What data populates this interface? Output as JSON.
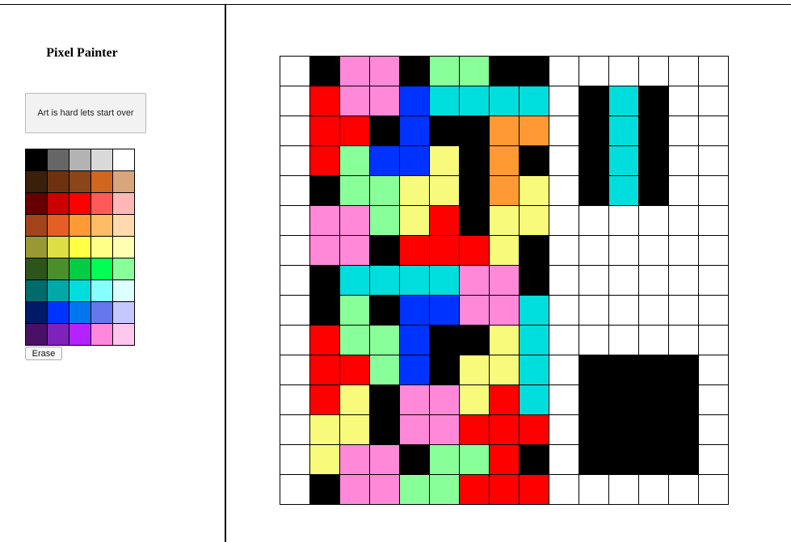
{
  "app": {
    "title": "Pixel Painter"
  },
  "sidebar": {
    "reset_label": "Art is hard lets start over",
    "erase_label": "Erase"
  },
  "palette": {
    "colors": [
      "#000000",
      "#666666",
      "#b3b3b3",
      "#d9d9d9",
      "#ffffff",
      "#3a1f0b",
      "#6e3210",
      "#8a4518",
      "#d1661f",
      "#d9a57d",
      "#660000",
      "#cc0000",
      "#ff0000",
      "#ff5a5a",
      "#ffb7b7",
      "#a3441a",
      "#e55e25",
      "#ff9933",
      "#ffbb66",
      "#ffd9b0",
      "#999933",
      "#dddd44",
      "#ffff44",
      "#ffff88",
      "#ffffb3",
      "#2d5419",
      "#4a8f2a",
      "#00cc44",
      "#00ff55",
      "#88ff99",
      "#006b6b",
      "#00a8a8",
      "#00dddd",
      "#88ffff",
      "#ddffff",
      "#001a66",
      "#0033ff",
      "#0077ee",
      "#6677ee",
      "#c7c7ff",
      "#4a1066",
      "#7f22bb",
      "#b422ff",
      "#ff88dd",
      "#ffc7ee"
    ]
  },
  "canvas": {
    "colors": {
      "W": "#ffffff",
      "K": "#000000",
      "P": "#ff88d8",
      "G": "#88ff99",
      "R": "#ff0000",
      "B": "#0033ff",
      "C": "#00dddd",
      "O": "#ff9933",
      "Y": "#f7fa7a"
    },
    "rows": [
      "WKPPKGGKKWWWWWW",
      "WRPPBCCCCWKCKWW",
      "WRRKBKKOOWKCKWW",
      "WRGBBYKOKWKCKWW",
      "WKGGYYKOYWKCKWW",
      "WPPGYRKYYWWWWWW",
      "WPPKRRRYKWWWWWW",
      "WKCCCCPPKWWWWWW",
      "WKGKBBPPCWWWWWW",
      "WRGGBKKYCWWWWWW",
      "WRRGBKYYCWKKKKW",
      "WRYKPPYRCWKKKKW",
      "WYYKPPRRRWKKKKW",
      "WYPPKGGRKWKKKKW",
      "WKPPGGRRRWWWWWW"
    ]
  }
}
